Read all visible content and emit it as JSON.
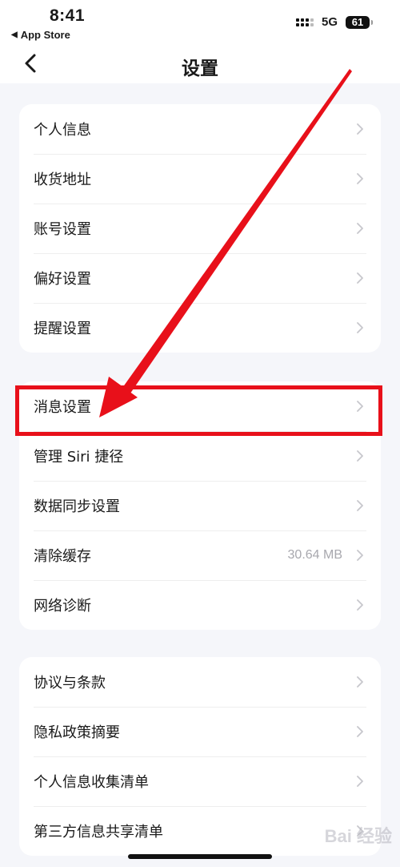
{
  "status_bar": {
    "time": "8:41",
    "back_app": "App Store",
    "network": "5G",
    "battery": "61"
  },
  "nav": {
    "title": "设置"
  },
  "groups": [
    {
      "items": [
        {
          "label": "个人信息"
        },
        {
          "label": "收货地址"
        },
        {
          "label": "账号设置"
        },
        {
          "label": "偏好设置"
        },
        {
          "label": "提醒设置"
        }
      ]
    },
    {
      "items": [
        {
          "label": "消息设置"
        },
        {
          "label": "管理 Siri 捷径"
        },
        {
          "label": "数据同步设置"
        },
        {
          "label": "清除缓存",
          "value": "30.64 MB"
        },
        {
          "label": "网络诊断"
        }
      ]
    },
    {
      "items": [
        {
          "label": "协议与条款"
        },
        {
          "label": "隐私政策摘要"
        },
        {
          "label": "个人信息收集清单"
        },
        {
          "label": "第三方信息共享清单"
        }
      ]
    }
  ],
  "annotation": {
    "highlight_color": "#e8101a"
  },
  "watermark": "Bai 经验"
}
